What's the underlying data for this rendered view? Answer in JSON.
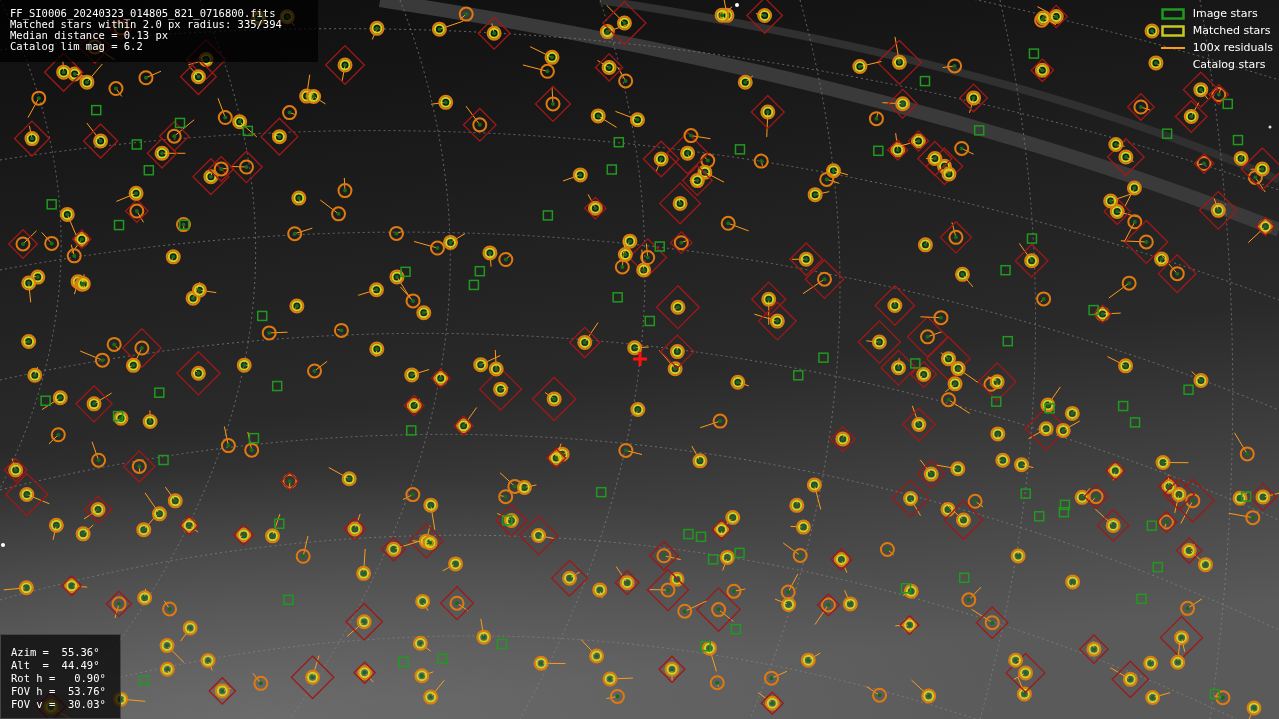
{
  "info": {
    "lines": [
      "FF_SI0006_20240323_014805_821_0716800.fits",
      "Matched stars within 2.0 px radius: 335/394",
      "Median distance = 0.13 px",
      "Catalog lim mag = 6.2"
    ]
  },
  "legend": [
    {
      "kind": "box",
      "color": "#1f9a1f",
      "label": "Image stars"
    },
    {
      "kind": "box",
      "color": "#c8c81e",
      "label": "Matched stars"
    },
    {
      "kind": "line",
      "color": "#ff9a1a",
      "label": "100x residuals"
    },
    {
      "kind": "none",
      "label": "Catalog stars"
    }
  ],
  "pointing": {
    "lines": [
      "Azim =  55.36°",
      "Alt  =  44.49°",
      "Rot h =   0.90°",
      "FOV h =  53.76°",
      "FOV v =  30.03°"
    ]
  }
}
